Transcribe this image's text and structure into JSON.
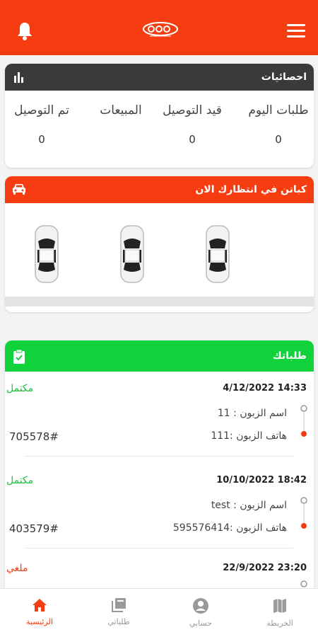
{
  "colors": {
    "accent": "#f63d12",
    "dark": "#3a3a3a",
    "green": "#10d33c"
  },
  "header": {
    "logo_icon": "brand-logo",
    "menu_icon": "hamburger-menu-icon",
    "bell_icon": "bell-icon"
  },
  "stats": {
    "title": "احصائيات",
    "icon": "bar-chart-icon",
    "items": [
      {
        "label": "طلبات اليوم",
        "value": "0"
      },
      {
        "label": "قيد التوصيل",
        "value": "0"
      },
      {
        "label": "المبيعات",
        "value": ""
      },
      {
        "label": "تم التوصيل",
        "value": "0"
      }
    ]
  },
  "captains": {
    "title": "كباتن في انتظارك الان",
    "icon": "car-icon",
    "car_icons": [
      "car-icon",
      "car-icon",
      "car-icon"
    ]
  },
  "orders": {
    "title": "طلباتك",
    "icon": "clipboard-check-icon",
    "items": [
      {
        "datetime": "4/12/2022 14:33",
        "status": "مكتمل",
        "customer_name": "اسم الزبون : 11",
        "customer_phone": "هاتف الزبون :111",
        "number": "705578#"
      },
      {
        "datetime": "10/10/2022 18:42",
        "status": "مكتمل",
        "customer_name": "اسم الزبون : test",
        "customer_phone": "هاتف الزبون :595576414",
        "number": "403579#"
      },
      {
        "datetime": "22/9/2022 23:20",
        "status": "ملغي",
        "customer_name": "",
        "customer_phone": "",
        "number": ""
      }
    ]
  },
  "nav": {
    "items": [
      {
        "label": "الرئيسية",
        "icon": "home-icon"
      },
      {
        "label": "طلباتي",
        "icon": "orders-library-icon"
      },
      {
        "label": "حسابي",
        "icon": "account-icon"
      },
      {
        "label": "الخريطة",
        "icon": "map-icon"
      }
    ]
  }
}
